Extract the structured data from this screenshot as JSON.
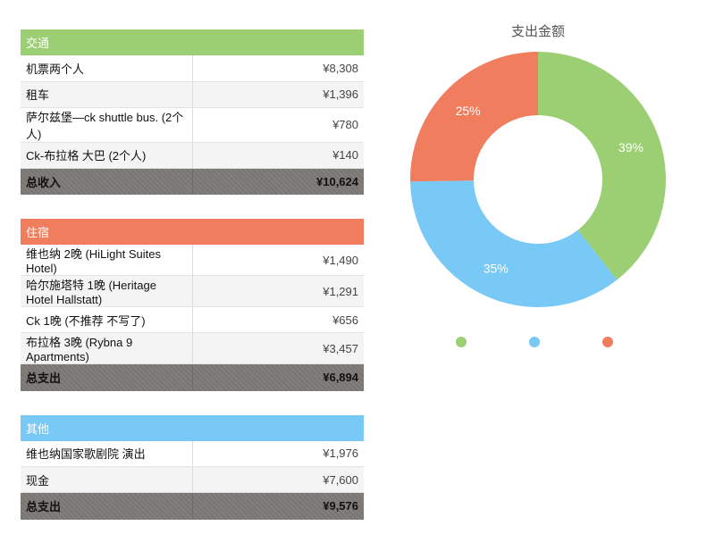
{
  "tables": [
    {
      "header": "交通",
      "color": "#9ccf74",
      "rows": [
        {
          "label": "机票两个人",
          "amount": "¥8,308"
        },
        {
          "label": "租车",
          "amount": "¥1,396"
        },
        {
          "label": "萨尔兹堡—ck  shuttle bus. (2个人)",
          "amount": "¥780"
        },
        {
          "label": "Ck-布拉格     大巴     (2个人)",
          "amount": "¥140"
        }
      ],
      "total": {
        "label": "总收入",
        "amount": "¥10,624"
      }
    },
    {
      "header": "住宿",
      "color": "#ef7d5e",
      "rows": [
        {
          "label": "维也纳 2晚  (HiLight Suites Hotel)",
          "amount": "¥1,490"
        },
        {
          "label": "哈尔施塔特 1晚  (Heritage Hotel Hallstatt)",
          "amount": "¥1,291"
        },
        {
          "label": "Ck 1晚  (不推荐 不写了)",
          "amount": "¥656"
        },
        {
          "label": "布拉格 3晚  (Rybna 9 Apartments)",
          "amount": "¥3,457"
        }
      ],
      "total": {
        "label": "总支出",
        "amount": "¥6,894"
      }
    },
    {
      "header": "其他",
      "color": "#79c9f6",
      "rows": [
        {
          "label": "维也纳国家歌剧院 演出",
          "amount": "¥1,976"
        },
        {
          "label": "现金",
          "amount": "¥7,600"
        }
      ],
      "total": {
        "label": "总支出",
        "amount": "¥9,576"
      }
    }
  ],
  "chart_data": {
    "type": "pie",
    "donut": true,
    "title": "支出金额",
    "slices": [
      {
        "label": "39%",
        "percent": 39,
        "color": "#9ccf74"
      },
      {
        "label": "35%",
        "percent": 35,
        "color": "#79c9f6"
      },
      {
        "label": "25%",
        "percent": 25,
        "color": "#ef7d5e"
      }
    ],
    "legend": {
      "placement": "bottom",
      "entries": [
        "",
        "",
        ""
      ]
    }
  }
}
